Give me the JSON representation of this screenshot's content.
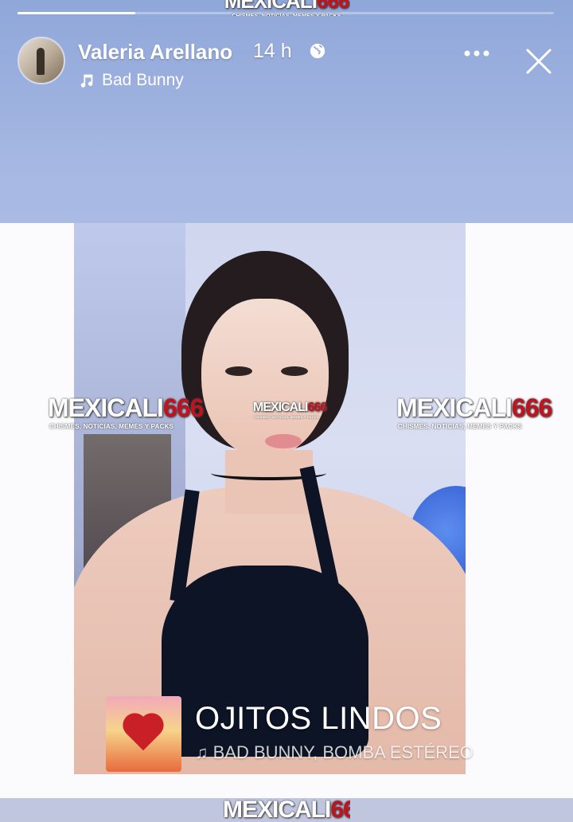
{
  "story": {
    "progress_fraction": 0.22,
    "author_name": "Valeria Arellano",
    "time_ago": "14 h",
    "privacy_icon": "globe-icon",
    "music_label": "Bad Bunny",
    "music_icon": "music-note-icon",
    "more_icon": "more-options-icon",
    "close_icon": "close-icon"
  },
  "sticker": {
    "song_title": "OJITOS LINDOS",
    "song_artist": "♫ BAD BUNNY, BOMBA ESTÉREO"
  },
  "watermark": {
    "brand_prefix": "MEXICALI",
    "brand_number": "666",
    "tagline": "CHISMES, NOTICIAS, MEMES Y PACKS"
  },
  "colors": {
    "background": "#a9b9dd",
    "watermark_red": "#c1121f",
    "text": "#ffffff"
  }
}
